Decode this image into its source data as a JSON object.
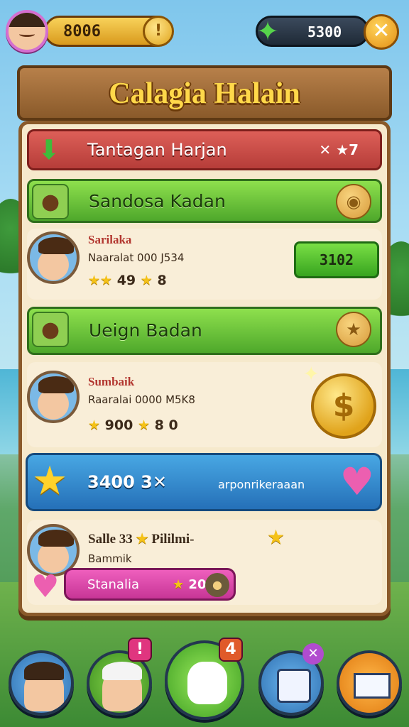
{
  "hud": {
    "coins": "8006",
    "gems": "5300",
    "coin_icon_glyph": "!",
    "gem_icon_glyph": "✦",
    "close_glyph": "✕"
  },
  "title": "Calagia Halain",
  "rows": {
    "red": {
      "label": "Tantagan Harjan",
      "meta": "✕ ★7",
      "icon": "down-arrow-icon"
    },
    "green1": {
      "label": "Sandosa Kadan",
      "icon_left": "cookie-icon",
      "icon_right": "bread-icon"
    },
    "green2": {
      "label": "Ueign Badan",
      "icon_left": "cookie-icon",
      "icon_right": "star-cookie-icon"
    },
    "blue": {
      "main": "3400 3✕",
      "sub": "arponrikeraaan",
      "icon_left": "star-icon",
      "icon_right": "heart-icon"
    }
  },
  "cards": [
    {
      "name": "Sarilaka",
      "sub": "Naaralat 000 J534",
      "stat1": "49",
      "stat2": "8",
      "score": "3102"
    },
    {
      "name": "Sumbaik",
      "sub": "Raaralai 0000 M5K8",
      "stat1": "900",
      "stat2": "8 0"
    },
    {
      "name": "Salle 33",
      "name_tail": "Pililmi-",
      "sub": "Bammik"
    }
  ],
  "pink_bar": {
    "label": "Stanalia",
    "value": "2030"
  },
  "badges": {
    "nav2": "!",
    "nav3": "4"
  },
  "colors": {
    "accent_green": "#4ea82b",
    "accent_red": "#b63d39",
    "accent_blue": "#2570b8",
    "accent_pink": "#c73596",
    "gold": "#e0a31b"
  }
}
